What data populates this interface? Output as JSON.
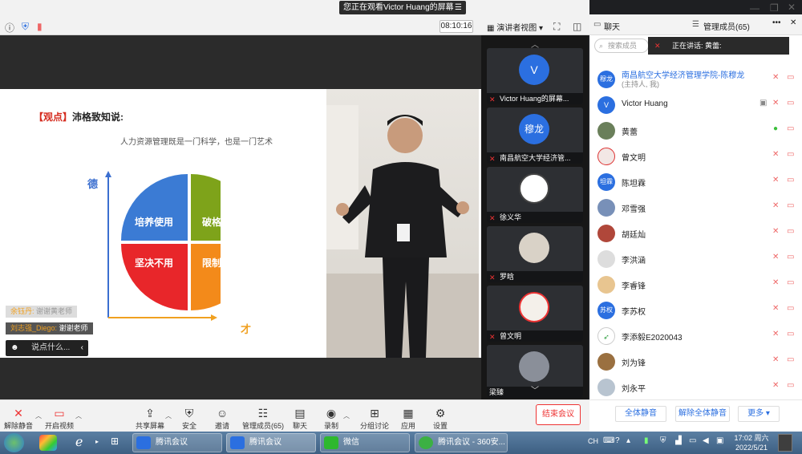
{
  "banner": {
    "text": "您正在观看Victor Huang的屏幕",
    "menu": "☰"
  },
  "topbar": {
    "clock": "08:10:16",
    "view_label": "演讲者视图"
  },
  "slide": {
    "tag": "【观点】",
    "headline": "沛格致知说:",
    "subtitle": "人力资源管理既是一门科学，也是一门艺术",
    "axis_y": "德",
    "axis_x": "才",
    "quadrants": [
      "培养使用",
      "破格重用",
      "坚决不用",
      "限制使用"
    ],
    "colors": {
      "tl": "#3b7bd4",
      "tr": "#7ea31a",
      "bl": "#e8262a",
      "br": "#f38a1a"
    }
  },
  "chat_overlay": {
    "msg1_name": "余钰丹:",
    "msg1_text": "谢谢黄老师",
    "msg2_name": "刘志强_Diego:",
    "msg2_text": "谢谢老师",
    "input_placeholder": "说点什么..."
  },
  "strip": {
    "tiles": [
      {
        "label": "Victor Huang的屏幕...",
        "avatar": "V"
      },
      {
        "label": "南昌航空大学经济管...",
        "avatar": "穆龙"
      },
      {
        "label": "徐义华",
        "avatar": ""
      },
      {
        "label": "罗晗",
        "avatar": ""
      },
      {
        "label": "曾文明",
        "avatar": ""
      },
      {
        "label": "梁臻",
        "avatar": ""
      }
    ]
  },
  "panel": {
    "tab_chat": "聊天",
    "tab_members": "管理成员(65)",
    "search_placeholder": "搜索成员",
    "speaking": "正在讲话: 黄蕾:",
    "members": [
      {
        "name": "南昌航空大学经济管理学院-陈穆龙",
        "sub": "(主持人, 我)",
        "av": "穆龙"
      },
      {
        "name": "Victor Huang",
        "av": "V"
      },
      {
        "name": "黄蕾",
        "av": ""
      },
      {
        "name": "曾文明",
        "av": ""
      },
      {
        "name": "陈坦霖",
        "av": "坦霖"
      },
      {
        "name": "邓雪强",
        "av": ""
      },
      {
        "name": "胡廷灿",
        "av": ""
      },
      {
        "name": "李洪涵",
        "av": ""
      },
      {
        "name": "李睿锋",
        "av": ""
      },
      {
        "name": "李苏权",
        "av": "苏权"
      },
      {
        "name": "李添毅E2020043",
        "av": ""
      },
      {
        "name": "刘为锋",
        "av": ""
      },
      {
        "name": "刘永平",
        "av": ""
      }
    ],
    "btn_mute_all": "全体静音",
    "btn_unmute_all": "解除全体静音",
    "btn_more": "更多"
  },
  "toolbar": {
    "unmute": "解除静音",
    "video": "开启视频",
    "share": "共享屏幕",
    "security": "安全",
    "invite": "邀请",
    "members": "管理成员(65)",
    "chat": "聊天",
    "record": "录制",
    "breakout": "分组讨论",
    "apps": "应用",
    "settings": "设置",
    "end": "结束会议"
  },
  "taskbar": {
    "tasks": [
      "腾讯会议",
      "腾讯会议",
      "微信",
      "腾讯会议 - 360安..."
    ],
    "lang": "CH",
    "time": "17:02 周六",
    "date": "2022/5/21"
  }
}
